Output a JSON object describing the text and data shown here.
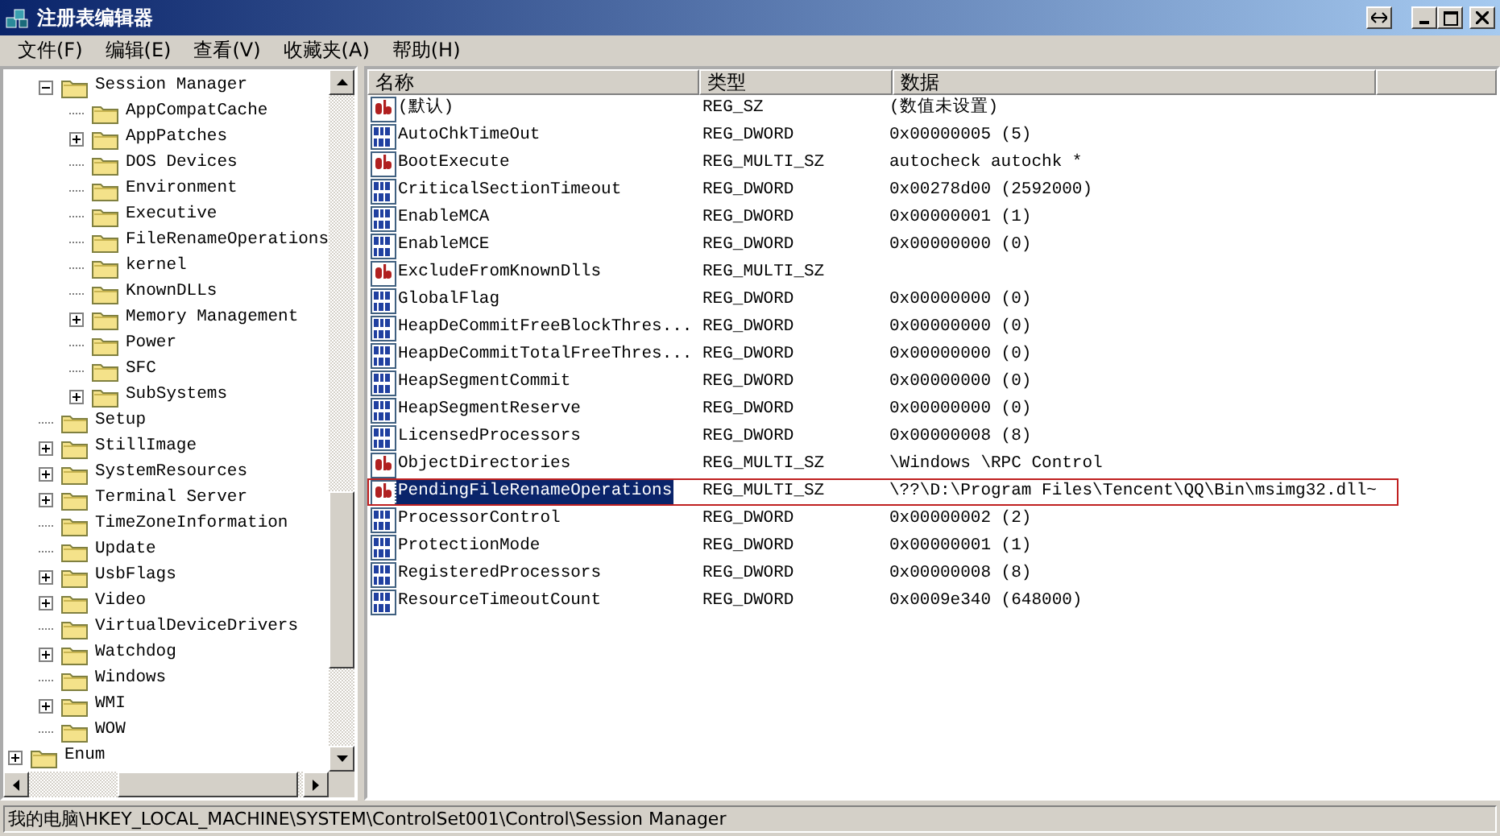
{
  "window": {
    "title": "注册表编辑器"
  },
  "menu": [
    "文件(F)",
    "编辑(E)",
    "查看(V)",
    "收藏夹(A)",
    "帮助(H)"
  ],
  "tree": [
    {
      "children": [
        {
          "label": "Session Manager",
          "expanded": true,
          "children": [
            {
              "label": "AppCompatCache"
            },
            {
              "label": "AppPatches",
              "expanded": false
            },
            {
              "label": "DOS Devices"
            },
            {
              "label": "Environment"
            },
            {
              "label": "Executive"
            },
            {
              "label": "FileRenameOperations"
            },
            {
              "label": "kernel"
            },
            {
              "label": "KnownDLLs"
            },
            {
              "label": "Memory Management",
              "expanded": false
            },
            {
              "label": "Power"
            },
            {
              "label": "SFC"
            },
            {
              "label": "SubSystems",
              "expanded": false
            }
          ]
        },
        {
          "label": "Setup"
        },
        {
          "label": "StillImage",
          "expanded": false
        },
        {
          "label": "SystemResources",
          "expanded": false
        },
        {
          "label": "Terminal Server",
          "expanded": false
        },
        {
          "label": "TimeZoneInformation"
        },
        {
          "label": "Update"
        },
        {
          "label": "UsbFlags",
          "expanded": false
        },
        {
          "label": "Video",
          "expanded": false
        },
        {
          "label": "VirtualDeviceDrivers"
        },
        {
          "label": "Watchdog",
          "expanded": false
        },
        {
          "label": "Windows"
        },
        {
          "label": "WMI",
          "expanded": false
        },
        {
          "label": "WOW"
        }
      ]
    },
    {
      "label": "Enum",
      "expanded": false
    }
  ],
  "table": {
    "columns": [
      "名称",
      "类型",
      "数据"
    ],
    "rows": [
      {
        "kind": "string",
        "name": "(默认)",
        "type": "REG_SZ",
        "data": "(数值未设置)",
        "selected": false,
        "outlined": false
      },
      {
        "kind": "binary",
        "name": "AutoChkTimeOut",
        "type": "REG_DWORD",
        "data": "0x00000005 (5)",
        "selected": false,
        "outlined": false
      },
      {
        "kind": "string",
        "name": "BootExecute",
        "type": "REG_MULTI_SZ",
        "data": "autocheck autochk *",
        "selected": false,
        "outlined": false
      },
      {
        "kind": "binary",
        "name": "CriticalSectionTimeout",
        "type": "REG_DWORD",
        "data": "0x00278d00 (2592000)",
        "selected": false,
        "outlined": false
      },
      {
        "kind": "binary",
        "name": "EnableMCA",
        "type": "REG_DWORD",
        "data": "0x00000001 (1)",
        "selected": false,
        "outlined": false
      },
      {
        "kind": "binary",
        "name": "EnableMCE",
        "type": "REG_DWORD",
        "data": "0x00000000 (0)",
        "selected": false,
        "outlined": false
      },
      {
        "kind": "string",
        "name": "ExcludeFromKnownDlls",
        "type": "REG_MULTI_SZ",
        "selected": false,
        "outlined": false
      },
      {
        "kind": "binary",
        "name": "GlobalFlag",
        "type": "REG_DWORD",
        "data": "0x00000000 (0)",
        "selected": false,
        "outlined": false
      },
      {
        "kind": "binary",
        "name": "HeapDeCommitFreeBlockThres...",
        "type": "REG_DWORD",
        "data": "0x00000000 (0)",
        "selected": false,
        "outlined": false
      },
      {
        "kind": "binary",
        "name": "HeapDeCommitTotalFreeThres...",
        "type": "REG_DWORD",
        "data": "0x00000000 (0)",
        "selected": false,
        "outlined": false
      },
      {
        "kind": "binary",
        "name": "HeapSegmentCommit",
        "type": "REG_DWORD",
        "data": "0x00000000 (0)",
        "selected": false,
        "outlined": false
      },
      {
        "kind": "binary",
        "name": "HeapSegmentReserve",
        "type": "REG_DWORD",
        "data": "0x00000000 (0)",
        "selected": false,
        "outlined": false
      },
      {
        "kind": "binary",
        "name": "LicensedProcessors",
        "type": "REG_DWORD",
        "data": "0x00000008 (8)",
        "selected": false,
        "outlined": false
      },
      {
        "kind": "string",
        "name": "ObjectDirectories",
        "type": "REG_MULTI_SZ",
        "data": "\\Windows \\RPC Control",
        "selected": false,
        "outlined": false
      },
      {
        "kind": "string",
        "name": "PendingFileRenameOperations",
        "type": "REG_MULTI_SZ",
        "data": "\\??\\D:\\Program Files\\Tencent\\QQ\\Bin\\msimg32.dll~",
        "selected": true,
        "outlined": true
      },
      {
        "kind": "binary",
        "name": "ProcessorControl",
        "type": "REG_DWORD",
        "data": "0x00000002 (2)",
        "selected": false,
        "outlined": false
      },
      {
        "kind": "binary",
        "name": "ProtectionMode",
        "type": "REG_DWORD",
        "data": "0x00000001 (1)",
        "selected": false,
        "outlined": false
      },
      {
        "kind": "binary",
        "name": "RegisteredProcessors",
        "type": "REG_DWORD",
        "data": "0x00000008 (8)",
        "selected": false,
        "outlined": false
      },
      {
        "kind": "binary",
        "name": "ResourceTimeoutCount",
        "type": "REG_DWORD",
        "data": "0x0009e340 (648000)",
        "selected": false,
        "outlined": false
      }
    ]
  },
  "status_bar": "我的电脑\\HKEY_LOCAL_MACHINE\\SYSTEM\\ControlSet001\\Control\\Session Manager"
}
